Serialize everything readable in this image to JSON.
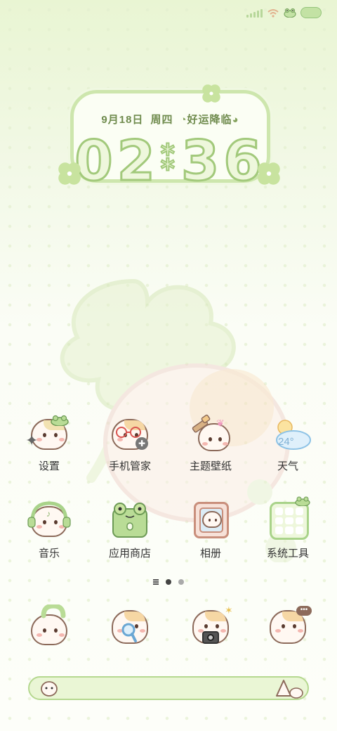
{
  "status_bar": {
    "signal_icon": "signal-bars-icon",
    "wifi_icon": "wifi-icon",
    "frog_icon": "frog-icon",
    "battery_icon": "frog-battery-icon"
  },
  "clock_widget": {
    "date": "9月18日",
    "weekday": "周四",
    "fortune": "好运降临",
    "hours": "02",
    "minutes": "36"
  },
  "apps_row1": [
    {
      "label": "设置",
      "icon": "settings-icon"
    },
    {
      "label": "手机管家",
      "icon": "phone-manager-icon"
    },
    {
      "label": "主题壁纸",
      "icon": "theme-wallpaper-icon"
    },
    {
      "label": "天气",
      "icon": "weather-icon",
      "temp": "24°"
    }
  ],
  "apps_row2": [
    {
      "label": "音乐",
      "icon": "music-icon"
    },
    {
      "label": "应用商店",
      "icon": "app-store-icon"
    },
    {
      "label": "相册",
      "icon": "gallery-icon"
    },
    {
      "label": "系统工具",
      "icon": "system-tools-icon"
    }
  ],
  "pager": {
    "pages": 2,
    "current": 1
  },
  "dock": [
    {
      "icon": "phone-icon"
    },
    {
      "icon": "browser-icon"
    },
    {
      "icon": "camera-icon"
    },
    {
      "icon": "messages-icon"
    }
  ],
  "search_bar": {
    "icon_left": "assistant-icon",
    "icon_right": "search-mascot-icon"
  },
  "colors": {
    "accent": "#a2c97b",
    "label": "#333333",
    "outline": "#8c6a5a"
  }
}
